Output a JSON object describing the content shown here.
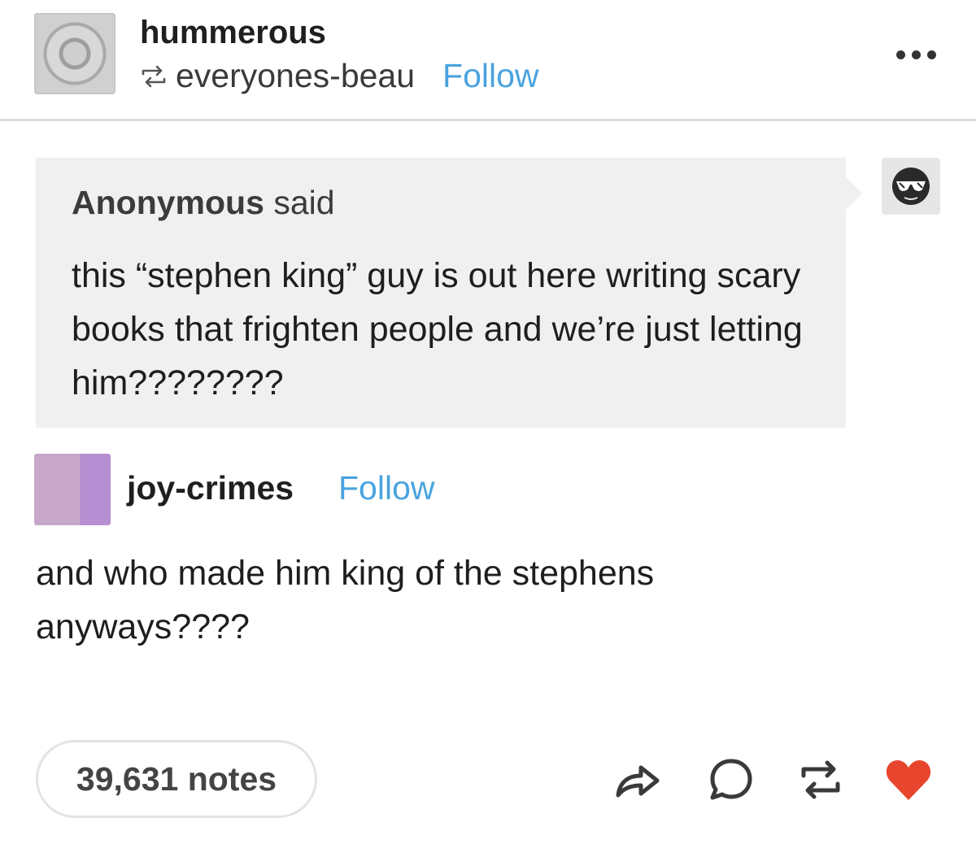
{
  "post": {
    "blog_name": "hummerous",
    "reblogged_from": "everyones-beau",
    "follow_label": "Follow"
  },
  "ask": {
    "asker": "Anonymous",
    "said": "said",
    "text": "this “stephen king” guy is out here writing scary books that frighten people and we’re just letting him????????"
  },
  "reply": {
    "blog_name": "joy-crimes",
    "follow_label": "Follow",
    "text": "and who made him king of the stephens anyways????"
  },
  "footer": {
    "notes": "39,631 notes"
  },
  "icons": {
    "menu": "more-dots-icon",
    "reblog_small": "reblog-icon",
    "anon": "anonymous-sunglasses-icon",
    "share": "share-icon",
    "reply": "reply-bubble-icon",
    "reblog": "reblog-icon",
    "like": "heart-icon"
  },
  "colors": {
    "link": "#4aa3df",
    "like": "#e8452f",
    "ask_bg": "#f0f0f0"
  }
}
